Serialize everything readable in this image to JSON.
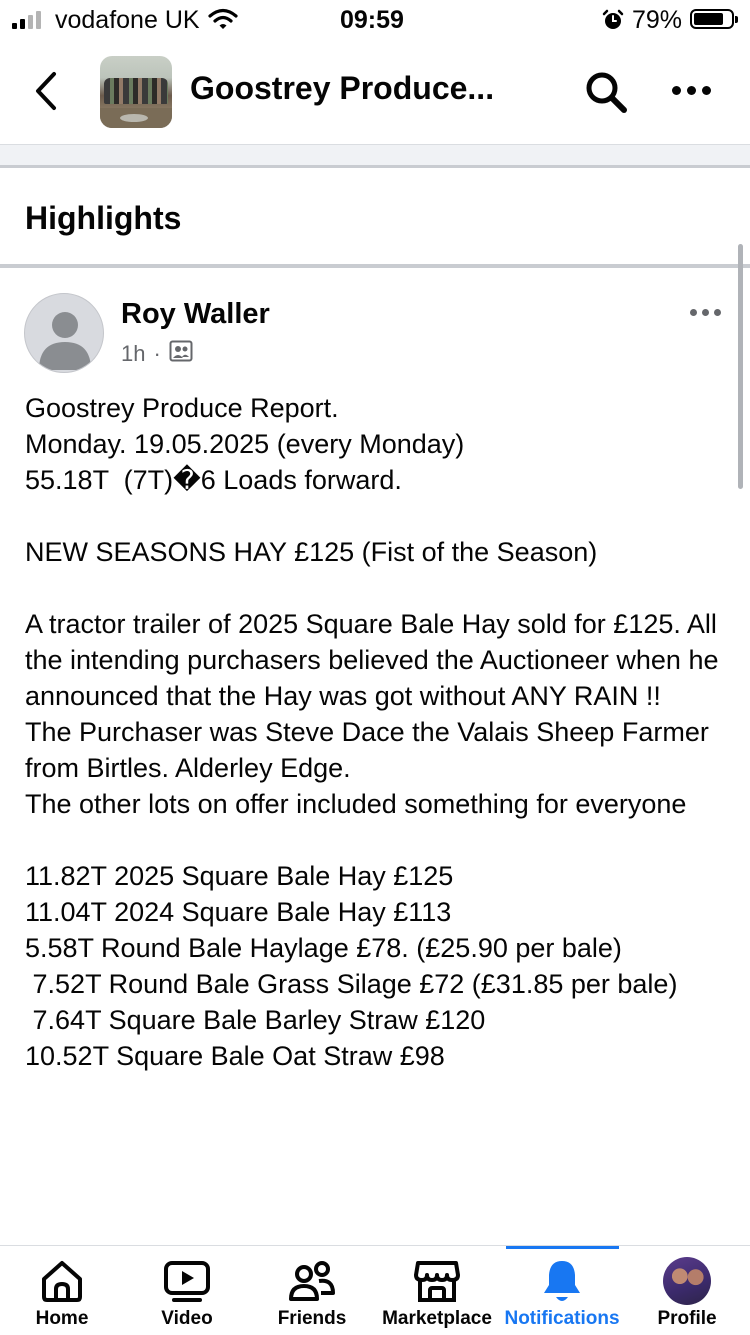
{
  "status_bar": {
    "carrier": "vodafone UK",
    "time": "09:59",
    "battery_percent": "79%",
    "battery_level": 0.79
  },
  "header": {
    "title": "Goostrey Produce...",
    "icons": [
      "back-icon",
      "group-cover-thumbnail",
      "search-icon",
      "more-icon"
    ]
  },
  "section": {
    "title": "Highlights"
  },
  "post": {
    "author": "Roy Waller",
    "time": "1h",
    "separator": "·",
    "audience_icon": "group-audience-icon",
    "body": "Goostrey Produce Report.\nMonday. 19.05.2025 (every Monday)\n55.18T  (7T)�6 Loads forward.\n\nNEW SEASONS HAY £125 (Fist of the Season)\n\nA tractor trailer of 2025 Square Bale Hay sold for £125. All the intending purchasers believed the Auctioneer when he announced that the Hay was got without ANY RAIN !!\nThe Purchaser was Steve Dace the Valais Sheep Farmer from Birtles. Alderley Edge.\nThe other lots on offer included something for everyone\n\n11.82T 2025 Square Bale Hay £125\n11.04T 2024 Square Bale Hay £113\n5.58T Round Bale Haylage £78. (£25.90 per bale)\n 7.52T Round Bale Grass Silage £72 (£31.85 per bale)\n 7.64T Square Bale Barley Straw £120\n10.52T Square Bale Oat Straw £98"
  },
  "tabs": [
    {
      "label": "Home",
      "icon": "home-icon"
    },
    {
      "label": "Video",
      "icon": "video-icon"
    },
    {
      "label": "Friends",
      "icon": "friends-icon"
    },
    {
      "label": "Marketplace",
      "icon": "marketplace-icon"
    },
    {
      "label": "Notifications",
      "icon": "bell-icon",
      "active": true
    },
    {
      "label": "Profile",
      "icon": "profile-avatar"
    }
  ],
  "colors": {
    "accent": "#1877f2",
    "text": "#050505",
    "secondary_text": "#65676b",
    "divider": "#c9ccd1"
  }
}
